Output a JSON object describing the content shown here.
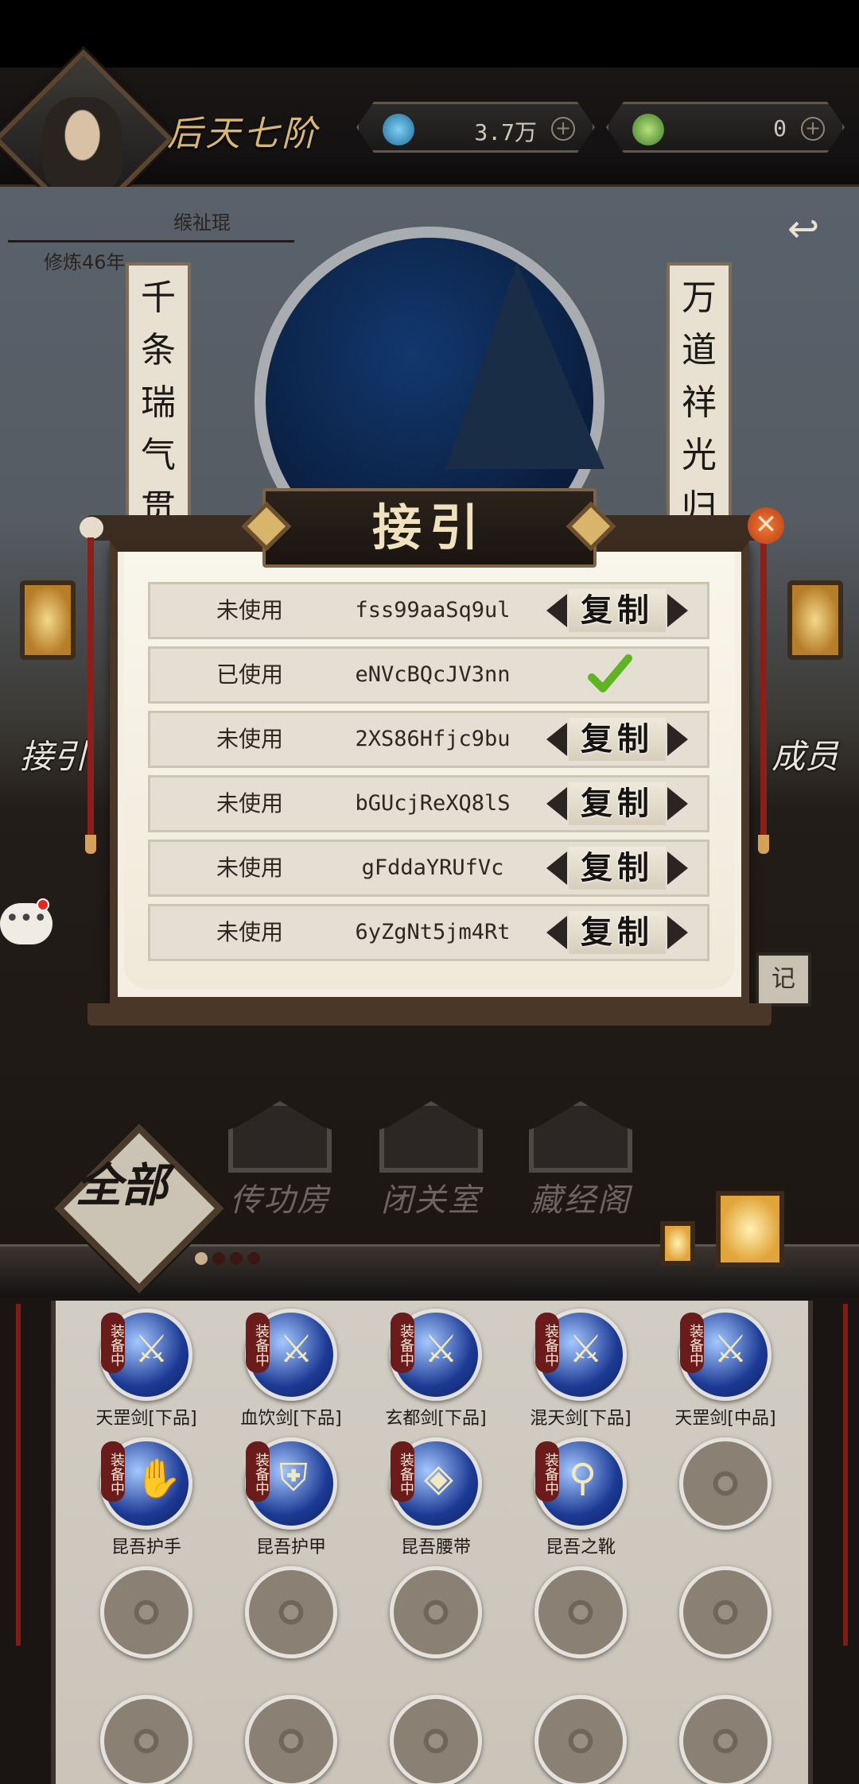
{
  "header": {
    "realm_title": "后天七阶",
    "player_name": "缑祉琨",
    "cultivation": "修炼46年",
    "currency_1": {
      "value": "3.7万",
      "icon": "spirit-crystal-icon"
    },
    "currency_2": {
      "value": "0",
      "icon": "jade-coin-icon"
    },
    "plus": "+"
  },
  "scene": {
    "couplet_left": "千条瑞气贯",
    "couplet_right": "万道祥光归",
    "side_left": "接引",
    "side_right": "成员",
    "chat": "•••",
    "record": "记"
  },
  "dialog": {
    "title": "接引",
    "close": "✕",
    "copy_label": "复制",
    "rows": [
      {
        "status": "未使用",
        "code": "fss99aaSq9ul",
        "used": false
      },
      {
        "status": "已使用",
        "code": "eNVcBQcJV3nn",
        "used": true
      },
      {
        "status": "未使用",
        "code": "2XS86Hfjc9bu",
        "used": false
      },
      {
        "status": "未使用",
        "code": "bGUcjReXQ8lS",
        "used": false
      },
      {
        "status": "未使用",
        "code": "gFddaYRUfVc",
        "used": false
      },
      {
        "status": "未使用",
        "code": "6yZgNt5jm4Rt",
        "used": false
      }
    ]
  },
  "buildings": [
    "传功房",
    "闭关室",
    "藏经阁"
  ],
  "all_tab": "全部",
  "equip_tag": "装备中",
  "items": [
    {
      "name": "天罡剑[下品]",
      "equipped": true
    },
    {
      "name": "血饮剑[下品]",
      "equipped": true
    },
    {
      "name": "玄都剑[下品]",
      "equipped": true
    },
    {
      "name": "混天剑[下品]",
      "equipped": true
    },
    {
      "name": "天罡剑[中品]",
      "equipped": true
    },
    {
      "name": "昆吾护手",
      "equipped": true
    },
    {
      "name": "昆吾护甲",
      "equipped": true
    },
    {
      "name": "昆吾腰带",
      "equipped": true
    },
    {
      "name": "昆吾之靴",
      "equipped": true
    }
  ],
  "colors": {
    "accent": "#d8b673",
    "dialog_border": "#4a3728",
    "close": "#e0582a"
  }
}
